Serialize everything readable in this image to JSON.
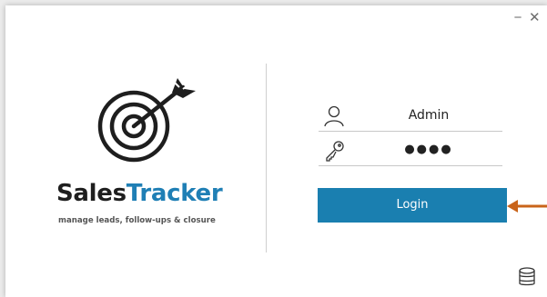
{
  "window": {
    "minimize_glyph": "−",
    "close_glyph": "✕"
  },
  "brand": {
    "name_part1": "Sales",
    "name_part2": "Tracker",
    "tagline": "manage leads, follow-ups & closure",
    "colors": {
      "dark": "#1e1e1e",
      "accent": "#1f7fb5"
    },
    "logo_icon": "target-arrow-icon"
  },
  "login": {
    "username_value": "Admin",
    "username_icon": "user-icon",
    "password_value": "●●●●",
    "password_icon": "key-icon",
    "button_label": "Login",
    "button_color": "#1a7fb0"
  },
  "annotation": {
    "arrow_color": "#c9641a",
    "arrow_icon": "pointer-arrow-icon"
  },
  "footer": {
    "icon": "database-icon"
  }
}
